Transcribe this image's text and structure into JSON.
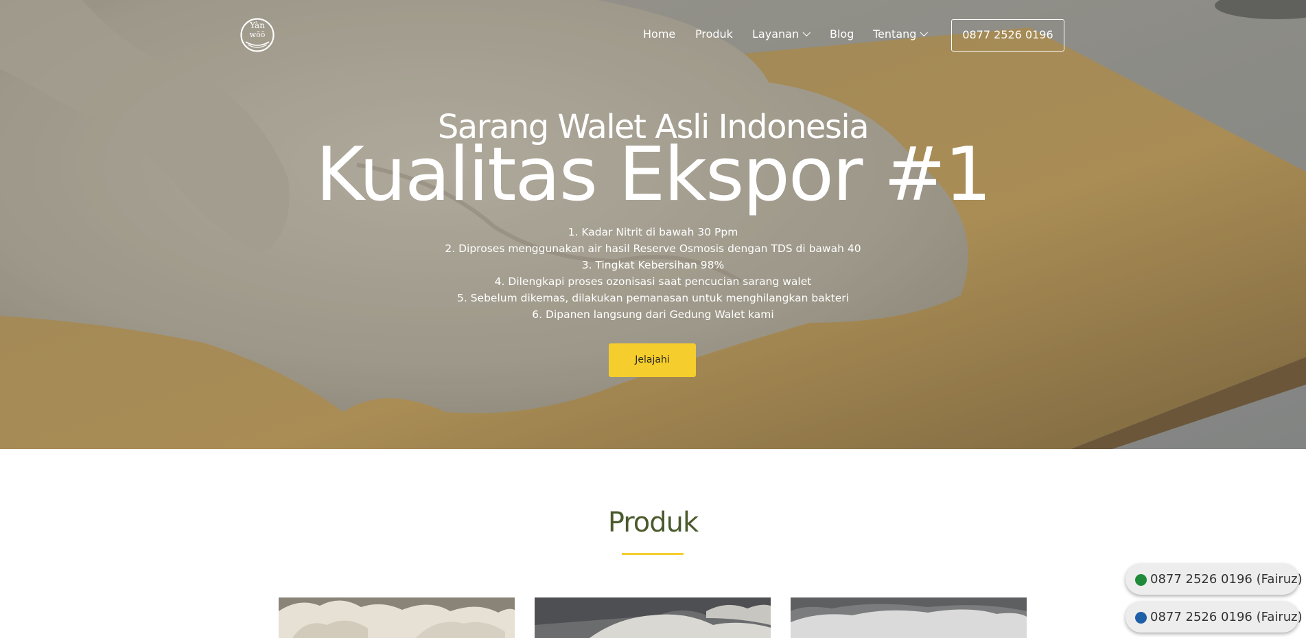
{
  "nav": {
    "logo_text_top": "Yàn",
    "logo_text_bottom": "wōō",
    "items": [
      {
        "label": "Home",
        "has_dropdown": false
      },
      {
        "label": "Produk",
        "has_dropdown": false
      },
      {
        "label": "Layanan",
        "has_dropdown": true
      },
      {
        "label": "Blog",
        "has_dropdown": false
      },
      {
        "label": "Tentang",
        "has_dropdown": true
      }
    ],
    "phone": "0877 2526 0196"
  },
  "hero": {
    "subtitle": "Sarang Walet Asli Indonesia",
    "title": "Kualitas Ekspor #1",
    "features": [
      "1. Kadar Nitrit di bawah 30 Ppm",
      "2. Diproses menggunakan air hasil Reserve Osmosis dengan TDS di bawah 40",
      "3. Tingkat Kebersihan 98%",
      "4. Dilengkapi proses ozonisasi saat pencucian sarang walet",
      "5. Sebelum dikemas, dilakukan pemanasan untuk menghilangkan bakteri",
      "6. Dipanen langsung dari Gedung Walet kami"
    ],
    "cta": "Jelajahi"
  },
  "products": {
    "title": "Produk"
  },
  "contact_buttons": [
    {
      "label": "0877 2526 0196 (Fairuz)",
      "icon": "whatsapp-icon",
      "color": "#1f8b3a"
    },
    {
      "label": "0877 2526 0196 (Fairuz)",
      "icon": "phone-icon",
      "color": "#1f5fa8"
    }
  ],
  "colors": {
    "accent": "#f5cd2c",
    "section_title": "#4a5a2c"
  }
}
